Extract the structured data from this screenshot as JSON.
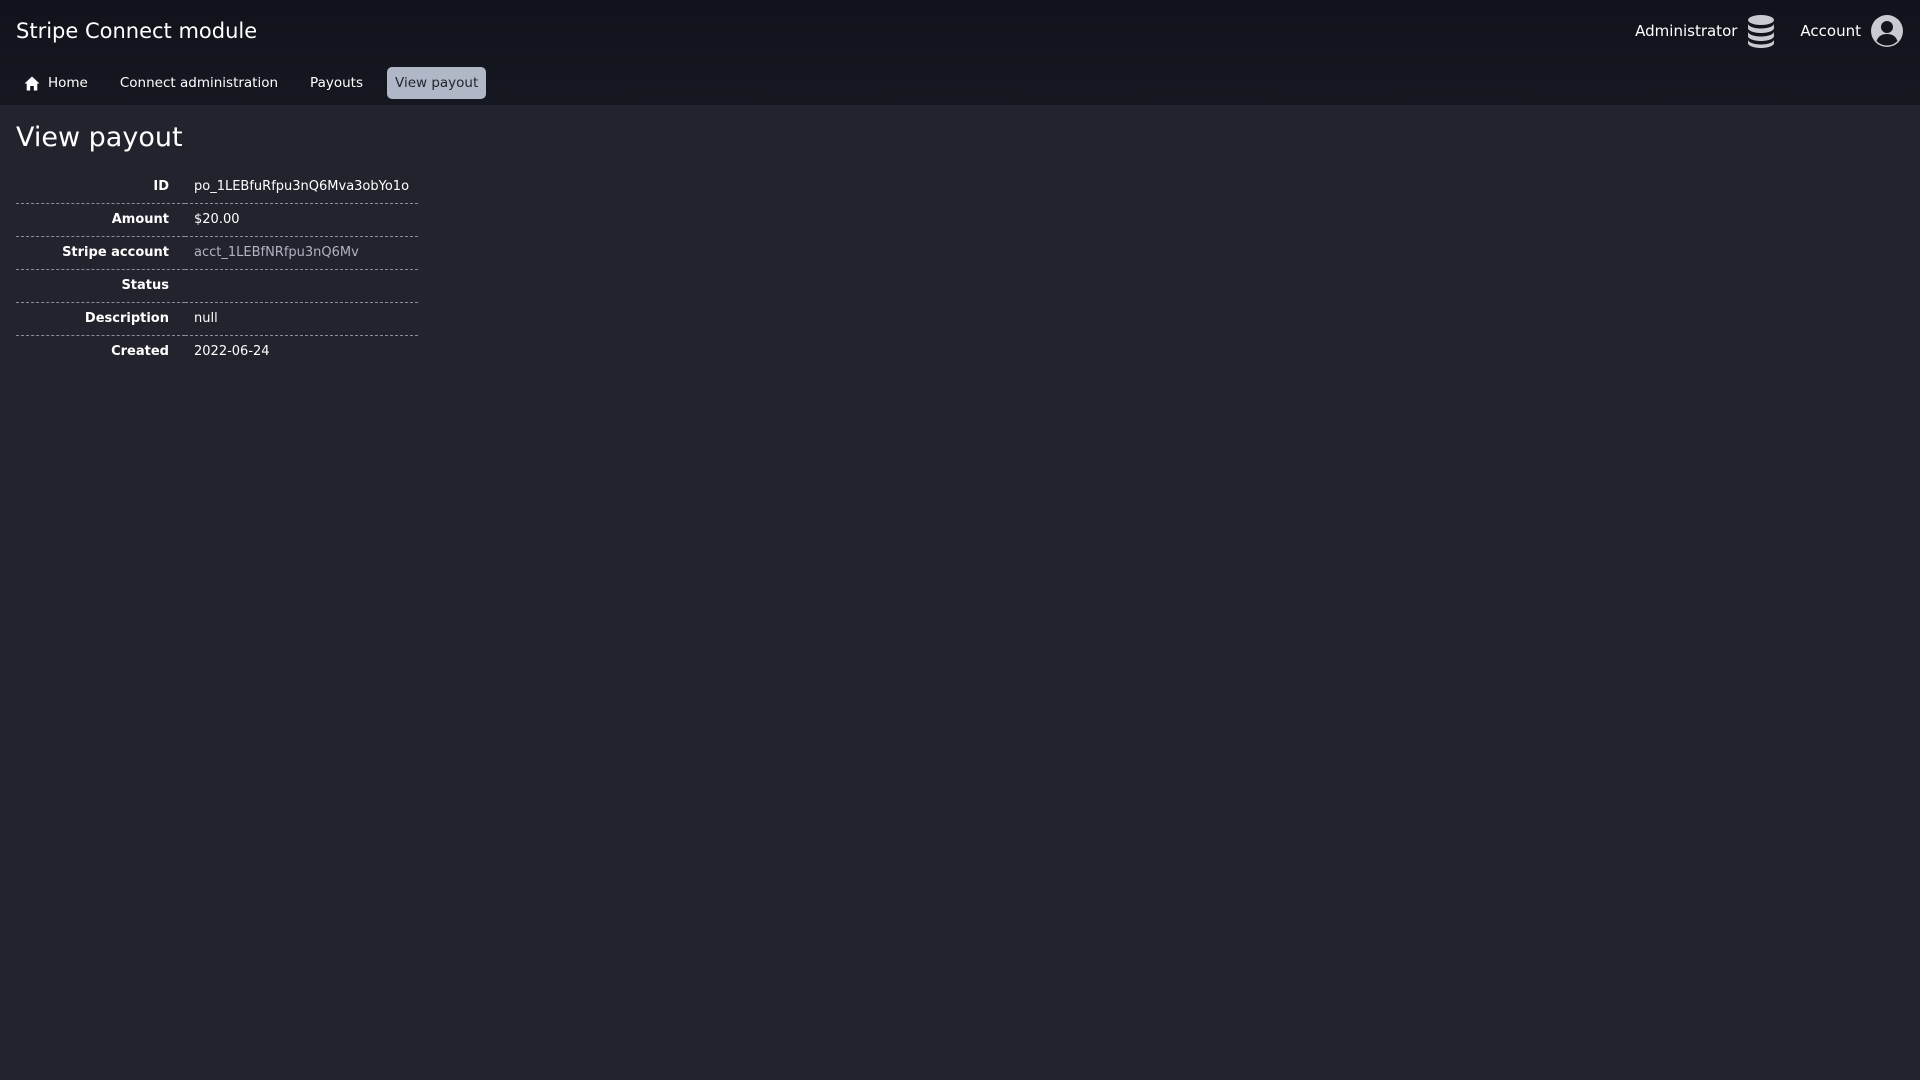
{
  "header": {
    "app_title": "Stripe Connect module",
    "admin_label": "Administrator",
    "admin_icon": "database-icon",
    "account_label": "Account",
    "account_icon": "user-circle-icon"
  },
  "nav": {
    "items": [
      {
        "label": "Home",
        "icon": "home-icon"
      },
      {
        "label": "Connect administration"
      },
      {
        "label": "Payouts"
      },
      {
        "label": "View payout",
        "active": true
      }
    ]
  },
  "page": {
    "title": "View payout"
  },
  "details": {
    "rows": [
      {
        "label": "ID",
        "value": "po_1LEBfuRfpu3nQ6Mva3obYo1o"
      },
      {
        "label": "Amount",
        "value": "$20.00"
      },
      {
        "label": "Stripe account",
        "value": "acct_1LEBfNRfpu3nQ6Mv"
      },
      {
        "label": "Status",
        "value": ""
      },
      {
        "label": "Description",
        "value": "null"
      },
      {
        "label": "Created",
        "value": "2022-06-24"
      }
    ]
  },
  "colors": {
    "background": "#22232c",
    "header_background": "#11121b",
    "active_tab_background": "#b0b7c6",
    "link": "#b0b4c3"
  }
}
